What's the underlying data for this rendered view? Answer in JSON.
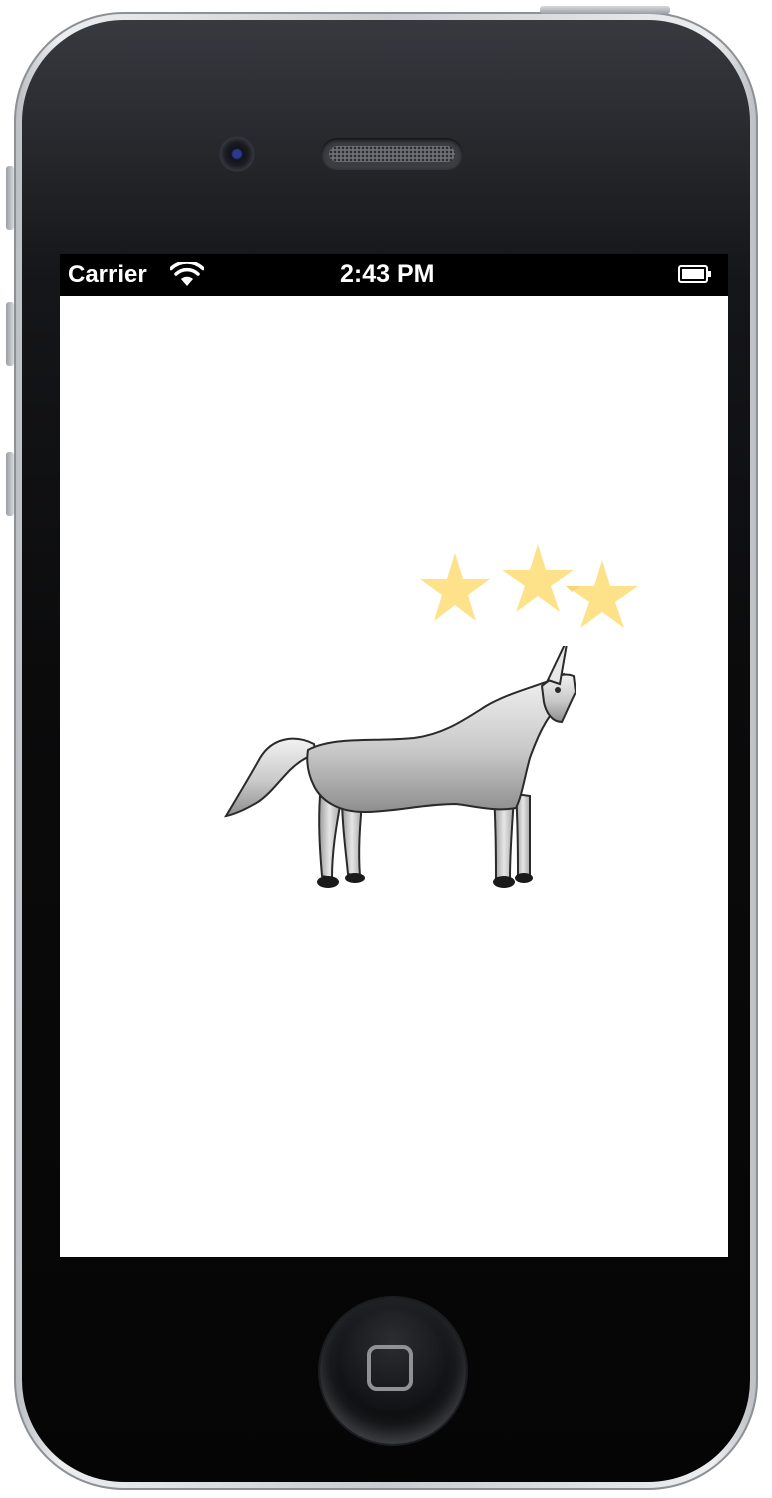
{
  "status_bar": {
    "carrier": "Carrier",
    "time": "2:43 PM",
    "wifi_icon": "wifi-icon",
    "battery_icon": "battery-icon"
  },
  "scene": {
    "rating_stars_shown": 3,
    "star_color": "#fde28a",
    "sprite": "unicorn-image"
  },
  "device": {
    "home_button_icon": "home-square-icon",
    "frame_color": "#0b0b0c",
    "screen_background": "#ffffff"
  }
}
